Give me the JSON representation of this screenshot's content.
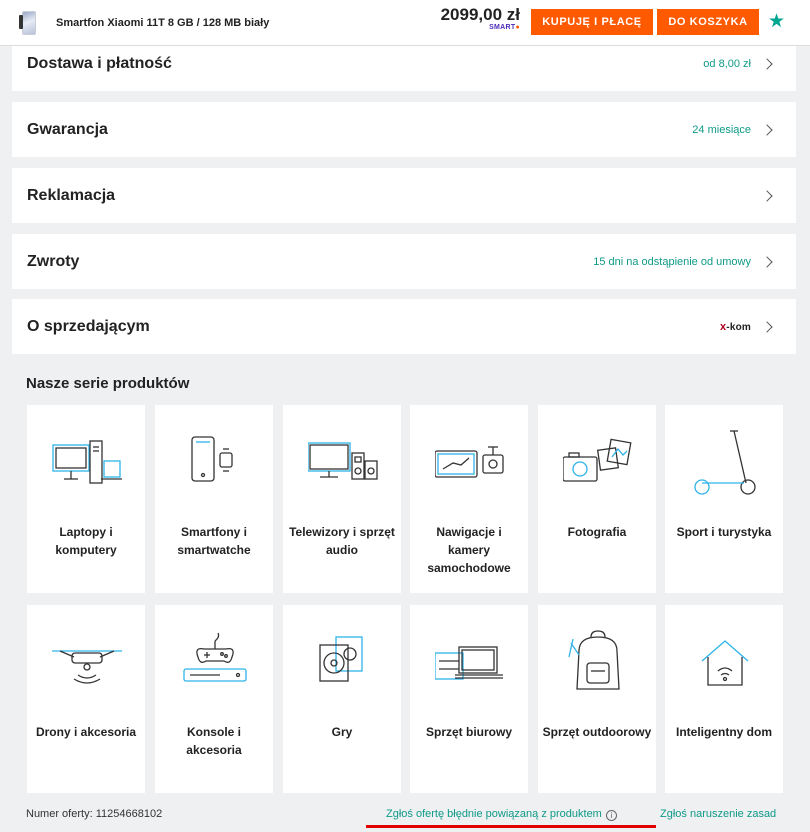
{
  "topbar": {
    "product_title": "Smartfon Xiaomi 11T 8 GB / 128 MB biały",
    "price": "2099,00 zł",
    "smart_badge": "SMART",
    "buy_button": "KUPUJĘ I PŁACĘ",
    "cart_button": "DO KOSZYKA"
  },
  "rows": [
    {
      "label": "Dostawa i płatność",
      "info": "od 8,00 zł"
    },
    {
      "label": "Gwarancja",
      "info": "24 miesiące"
    },
    {
      "label": "Reklamacja",
      "info": ""
    },
    {
      "label": "Zwroty",
      "info": "15 dni na odstąpienie od umowy"
    },
    {
      "label": "O sprzedającym",
      "info": ""
    }
  ],
  "seller_logo": {
    "x": "x",
    "brand": "-kom"
  },
  "series": {
    "heading": "Nasze serie produktów",
    "tiles": [
      {
        "label": "Laptopy i komputery",
        "icon": "laptop-computer-icon"
      },
      {
        "label": "Smartfony i smartwatche",
        "icon": "smartphone-watch-icon"
      },
      {
        "label": "Telewizory i sprzęt audio",
        "icon": "tv-audio-icon"
      },
      {
        "label": "Nawigacje i kamery samochodowe",
        "icon": "navigation-camera-icon"
      },
      {
        "label": "Fotografia",
        "icon": "camera-photo-icon"
      },
      {
        "label": "Sport i turystyka",
        "icon": "scooter-icon"
      },
      {
        "label": "Drony i akcesoria",
        "icon": "drone-icon"
      },
      {
        "label": "Konsole i akcesoria",
        "icon": "console-gamepad-icon"
      },
      {
        "label": "Gry",
        "icon": "game-disc-icon"
      },
      {
        "label": "Sprzęt biurowy",
        "icon": "office-printer-icon"
      },
      {
        "label": "Sprzęt outdoorowy",
        "icon": "backpack-icon"
      },
      {
        "label": "Inteligentny dom",
        "icon": "smart-home-icon"
      }
    ]
  },
  "footer": {
    "offer_label": "Numer oferty:",
    "offer_number": "11254668102",
    "report_link": "Zgłoś ofertę błędnie powiązaną z produktem",
    "violation_link": "Zgłoś naruszenie zasad"
  },
  "colors": {
    "accent": "#ff5a00",
    "link": "#0f9a87",
    "icon_blue": "#2fb3e8",
    "underline": "#e00000"
  }
}
